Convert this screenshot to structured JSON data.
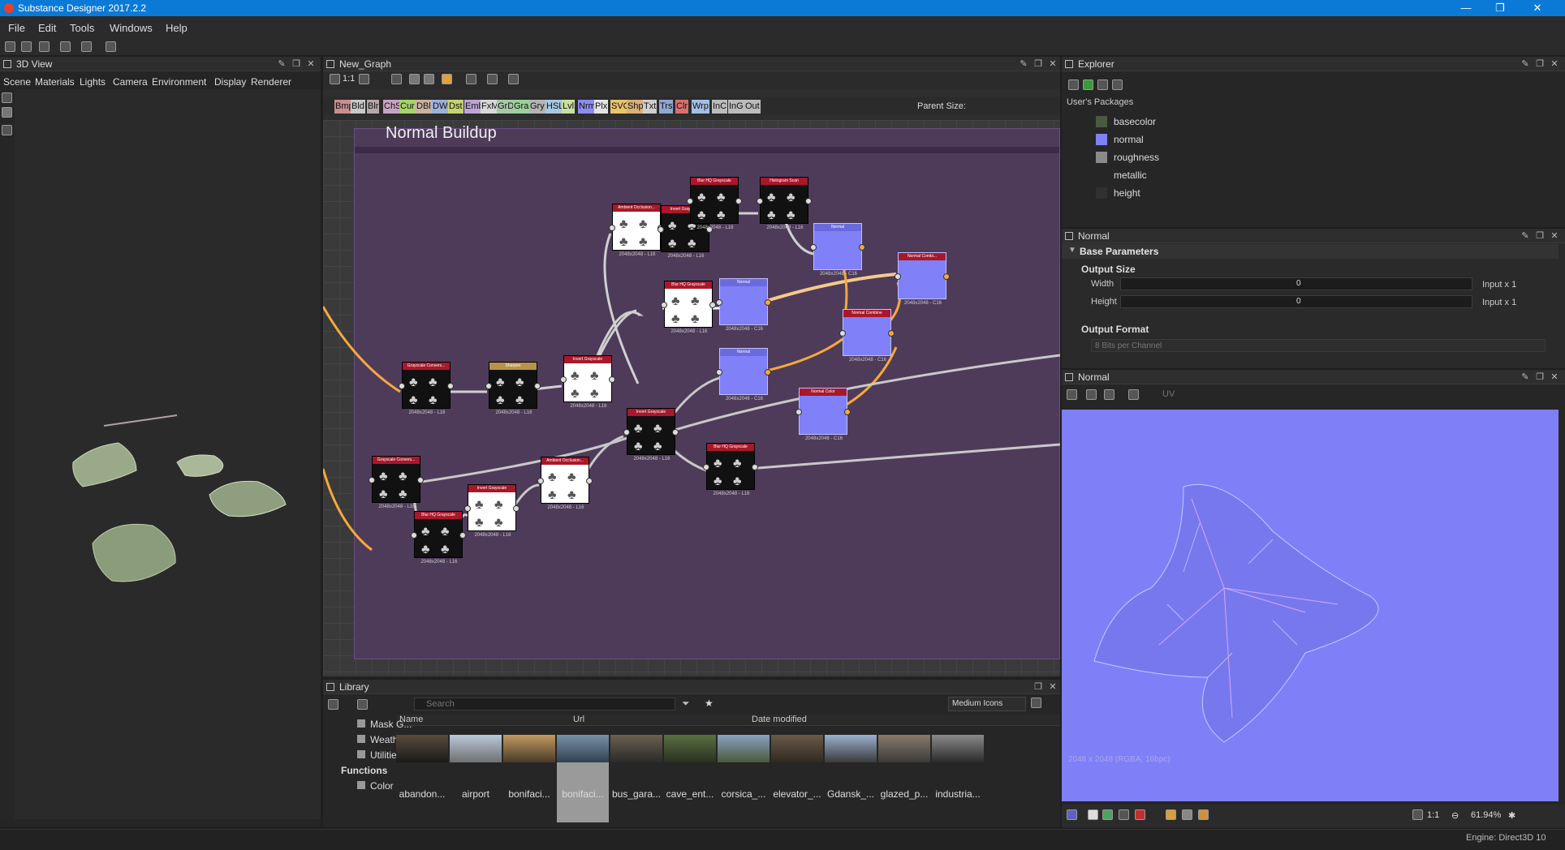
{
  "title": "Substance Designer 2017.2.2",
  "window_buttons": [
    "—",
    "❐",
    "✕"
  ],
  "menu": [
    "File",
    "Edit",
    "Tools",
    "Windows",
    "Help"
  ],
  "view3d": {
    "title": "3D View",
    "submenu": [
      "Scene",
      "Materials",
      "Lights",
      "Camera",
      "Environment",
      "Display",
      "Renderer"
    ]
  },
  "graph": {
    "tab_title": "New_Graph",
    "zoom_label": "1:1",
    "parent_size_label": "Parent Size:",
    "frame_title": "Normal Buildup",
    "chips": [
      {
        "t": "Bmp",
        "c": "#c98f8f"
      },
      {
        "t": "Bld",
        "c": "#c8c8c8"
      },
      {
        "t": "Blr",
        "c": "#b7a8a8"
      },
      {
        "t": "ChS",
        "c": "#c9a2c2"
      },
      {
        "t": "Cur",
        "c": "#a8d26a"
      },
      {
        "t": "DBl",
        "c": "#c9b3a2"
      },
      {
        "t": "DWr",
        "c": "#9fb0d8"
      },
      {
        "t": "Dst",
        "c": "#c7d46e"
      },
      {
        "t": "Emb",
        "c": "#bfa6d6"
      },
      {
        "t": "FxM",
        "c": "#d8d8d8"
      },
      {
        "t": "GrD",
        "c": "#a8c8a8"
      },
      {
        "t": "Gra",
        "c": "#9ad29a"
      },
      {
        "t": "Gry",
        "c": "#b4b4b4"
      },
      {
        "t": "HSL",
        "c": "#a6c9e0"
      },
      {
        "t": "Lvl",
        "c": "#c8e0a0"
      },
      {
        "t": "Nrm",
        "c": "#8c8cf2"
      },
      {
        "t": "Plx",
        "c": "#e4e4e4"
      },
      {
        "t": "SVG",
        "c": "#e8c46a"
      },
      {
        "t": "Shp",
        "c": "#d9b07a"
      },
      {
        "t": "Txt",
        "c": "#cfcfcf"
      },
      {
        "t": "Trs",
        "c": "#90a8d0"
      },
      {
        "t": "Clr",
        "c": "#d87070"
      },
      {
        "t": "Wrp",
        "c": "#a2c0e6"
      },
      {
        "t": "InC",
        "c": "#bcbcbc"
      },
      {
        "t": "InG",
        "c": "#bcbcbc"
      },
      {
        "t": "Out",
        "c": "#bcbcbc"
      }
    ],
    "nodes": {
      "gray_conv1": {
        "title": "Grayscale Convers...",
        "size": "2048x2048 - L16"
      },
      "sharpen": {
        "title": "Sharpen",
        "size": "2048x2048 - L16"
      },
      "invert1": {
        "title": "Invert Grayscale",
        "size": "2048x2048 - L16"
      },
      "ao1": {
        "title": "Ambient Occlusion...",
        "size": "2048x2048 - L16"
      },
      "invert2": {
        "title": "Invert Grayscale",
        "size": "2048x2048 - L16"
      },
      "blur1": {
        "title": "Blur HQ Grayscale",
        "size": "2048x2048 - L16"
      },
      "hist": {
        "title": "Histogram Scan",
        "size": "2048x2048 - L16"
      },
      "normal1": {
        "title": "Normal",
        "size": "2048x2048 - C16"
      },
      "blur2": {
        "title": "Blur HQ Grayscale",
        "size": "2048x2048 - L16"
      },
      "normal2": {
        "title": "Normal",
        "size": "2048x2048 - C16"
      },
      "ncomb1": {
        "title": "Normal Combine",
        "size": "2048x2048 - C16"
      },
      "ncomb2": {
        "title": "Normal Combi...",
        "size": "2048x2048 - C16"
      },
      "normal3": {
        "title": "Normal",
        "size": "2048x2048 - C16"
      },
      "invert3": {
        "title": "Invert Grayscale",
        "size": "2048x2048 - L16"
      },
      "ncolor": {
        "title": "Normal Color",
        "size": "2048x2048 - C16"
      },
      "blur3": {
        "title": "Blur HQ Grayscale",
        "size": "2048x2048 - L16"
      },
      "gray_conv2": {
        "title": "Grayscale Convers...",
        "size": "2048x2048 - L16"
      },
      "blur4": {
        "title": "Blur HQ Grayscale",
        "size": "2048x2048 - L16"
      },
      "invert4": {
        "title": "Invert Grayscale",
        "size": "2048x2048 - L16"
      },
      "ao2": {
        "title": "Ambient Occlusion...",
        "size": "2048x2048 - L16"
      }
    }
  },
  "explorer": {
    "title": "Explorer",
    "packages_label": "User's Packages",
    "items": [
      {
        "label": "basecolor",
        "icon": "texture-icon",
        "c": "#4a5a40"
      },
      {
        "label": "normal",
        "icon": "normal-swatch-icon",
        "c": "#8080f8"
      },
      {
        "label": "roughness",
        "icon": "gray-swatch-icon",
        "c": "#8a8a8a"
      },
      {
        "label": "metallic",
        "icon": "empty-swatch-icon",
        "c": "#262626"
      },
      {
        "label": "height",
        "icon": "height-swatch-icon",
        "c": "#303030"
      }
    ]
  },
  "props": {
    "title": "Normal",
    "section": "Base Parameters",
    "output_size_label": "Output Size",
    "width_label": "Width",
    "width_value": "0",
    "width_suffix": "Input x 1",
    "height_label": "Height",
    "height_value": "0",
    "height_suffix": "Input x 1",
    "output_format_label": "Output Format",
    "output_format_value": "8 Bits per Channel"
  },
  "view2d": {
    "title": "Normal",
    "uv_label": "UV",
    "info": "2048 x 2048 (RGBA, 16bpc)",
    "ratio": "1:1",
    "zoom": "61.94%"
  },
  "library": {
    "title": "Library",
    "search_placeholder": "Search",
    "view_mode": "Medium Icons",
    "columns": [
      "Name",
      "Url",
      "Date modified"
    ],
    "tree": [
      {
        "label": "Mask G...",
        "icon": "folder-icon"
      },
      {
        "label": "Weathe...",
        "icon": "folder-icon"
      },
      {
        "label": "Utilities",
        "icon": "folder-icon"
      },
      {
        "label": "Functions",
        "icon": "folder-icon"
      },
      {
        "label": "Color",
        "icon": "folder-icon"
      }
    ],
    "thumbnails": [
      {
        "label": "abandon...",
        "c1": "#5a4a3a",
        "c2": "#1a1a1a"
      },
      {
        "label": "airport",
        "c1": "#b8c8d8",
        "c2": "#707070"
      },
      {
        "label": "bonifaci...",
        "c1": "#c09a60",
        "c2": "#4a3a28"
      },
      {
        "label": "bonifaci...",
        "c1": "#7a90a8",
        "c2": "#304050"
      },
      {
        "label": "bus_gara...",
        "c1": "#6a6050",
        "c2": "#2a2a2a"
      },
      {
        "label": "cave_ent...",
        "c1": "#5a7040",
        "c2": "#2a3020"
      },
      {
        "label": "corsica_...",
        "c1": "#8aa0c0",
        "c2": "#4a5a3a"
      },
      {
        "label": "elevator_...",
        "c1": "#6a5a48",
        "c2": "#302820"
      },
      {
        "label": "Gdansk_...",
        "c1": "#9ab0d0",
        "c2": "#3a3a3a"
      },
      {
        "label": "glazed_p...",
        "c1": "#8a7a6a",
        "c2": "#3a3a3a"
      },
      {
        "label": "industria...",
        "c1": "#8a8a8a",
        "c2": "#2a2a2a"
      }
    ]
  },
  "status": {
    "engine": "Engine: Direct3D 10"
  },
  "colors": {
    "accent": "#0b7ad6",
    "frame": "#4e3b5a",
    "normal_node": "#8080f8",
    "wire_orange": "#f5a93c",
    "wire_white": "#d0d0d0"
  }
}
